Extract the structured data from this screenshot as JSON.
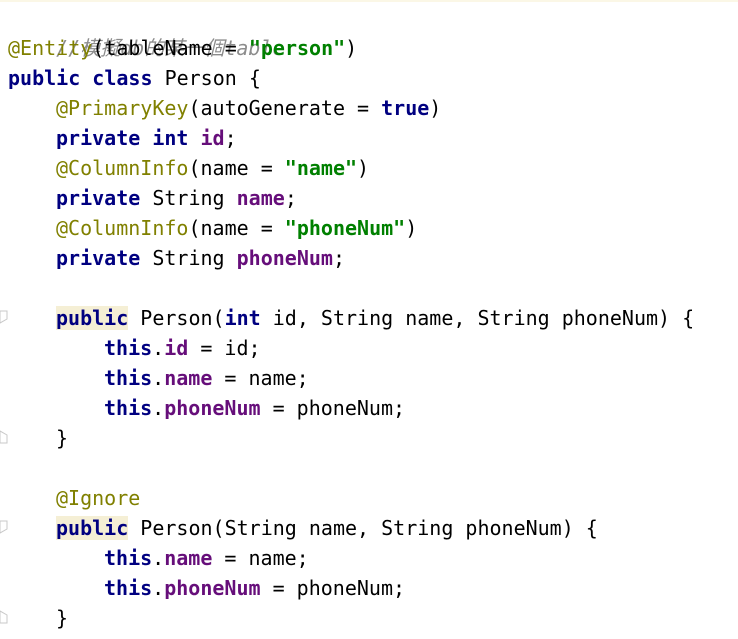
{
  "code": {
    "comment": "//模擬db的某一個table",
    "entity_anno": "@Entity",
    "entity_args_open": "(tableName = ",
    "entity_table": "\"person\"",
    "entity_args_close": ")",
    "kw_public": "public",
    "kw_class": "class",
    "class_name": "Person {",
    "pk_anno": "@PrimaryKey",
    "pk_args_open": "(autoGenerate = ",
    "pk_true": "true",
    "pk_args_close": ")",
    "kw_private": "private",
    "kw_int": "int",
    "field_id": "id",
    "semicolon": ";",
    "colinfo_anno": "@ColumnInfo",
    "colinfo_args_open": "(name = ",
    "colinfo_name": "\"name\"",
    "colinfo_phone": "\"phoneNum\"",
    "close_paren": ")",
    "type_string": "String",
    "field_name": "name",
    "field_phone": "phoneNum",
    "ctor1_rest": " Person(",
    "ctor1_params": " id, String name, String phoneNum) {",
    "kw_this": "this",
    "dot": ".",
    "assign_id": " = id;",
    "assign_name": " = name;",
    "assign_phone": " = phoneNum;",
    "close_brace": "}",
    "ignore_anno": "@Ignore",
    "ctor2_rest": " Person(String name, String phoneNum) {"
  },
  "colors": {
    "comment": "#8c8c8c",
    "annotation": "#808000",
    "keyword": "#000080",
    "string": "#008000",
    "field": "#660e7a",
    "highlight": "#f5efd5"
  }
}
